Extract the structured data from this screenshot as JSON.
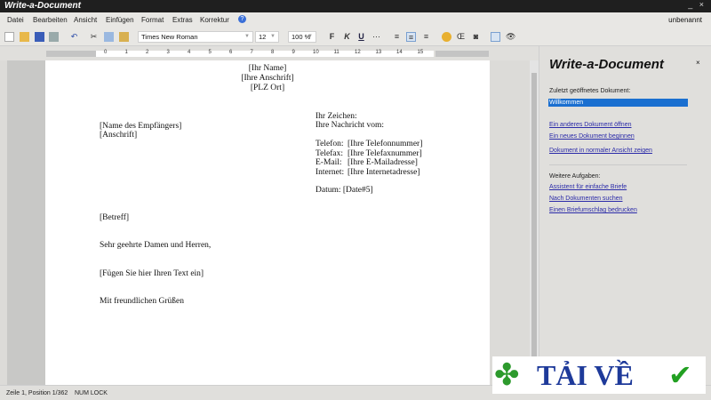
{
  "app": {
    "title": "Write-a-Document",
    "doc_name": "unbenannt",
    "minimize": "_",
    "close": "×"
  },
  "menu": [
    "Datei",
    "Bearbeiten",
    "Ansicht",
    "Einfügen",
    "Format",
    "Extras",
    "Korrektur"
  ],
  "toolbar": {
    "font": "Times New Roman",
    "size": "12",
    "zoom": "100 %",
    "bold": "F",
    "italic": "K",
    "underline": "U"
  },
  "ruler": [
    "0",
    "1",
    "2",
    "3",
    "4",
    "5",
    "6",
    "7",
    "8",
    "9",
    "10",
    "11",
    "12",
    "13",
    "14",
    "15"
  ],
  "document": {
    "header": [
      "[Ihr Name]",
      "[Ihre Anschrift]",
      "[PLZ Ort]"
    ],
    "recipient": [
      "[Name des Empfängers]",
      "[Anschrift]"
    ],
    "ref": [
      "Ihr Zeichen:",
      "Ihre Nachricht vom:"
    ],
    "contact": [
      [
        "Telefon:",
        "[Ihre Telefonnummer]"
      ],
      [
        "Telefax:",
        "[Ihre Telefaxnummer]"
      ],
      [
        "E-Mail:",
        "[Ihre E-Mailadresse]"
      ],
      [
        "Internet:",
        "[Ihre Internetadresse]"
      ]
    ],
    "date": "Datum: [Date#5]",
    "subject": "[Betreff]",
    "salutation": "Sehr geehrte Damen und Herren,",
    "body": "[Fügen Sie hier Ihren Text ein]",
    "closing": "Mit freundlichen Grüßen"
  },
  "panel": {
    "title": "Write-a-Document",
    "close": "×",
    "recent_label": "Zuletzt geöffnetes Dokument:",
    "recent_item": "Willkommen",
    "links": [
      "Ein anderes Dokument öffnen",
      "Ein neues Dokument beginnen",
      "Dokument in normaler Ansicht zeigen"
    ],
    "more_label": "Weitere Aufgaben:",
    "tasks": [
      "Assistent für einfache Briefe",
      "Nach Dokumenten suchen",
      "Einen Briefumschlag bedrucken"
    ]
  },
  "status": {
    "position": "Zeile 1, Position 1/362",
    "numlock": "NUM LOCK"
  },
  "watermark": {
    "text": "TẢI VỀ"
  },
  "colors": {
    "titlebar": "#1f1f1f",
    "link": "#2a2aa8",
    "selection": "#1a6fd0"
  }
}
